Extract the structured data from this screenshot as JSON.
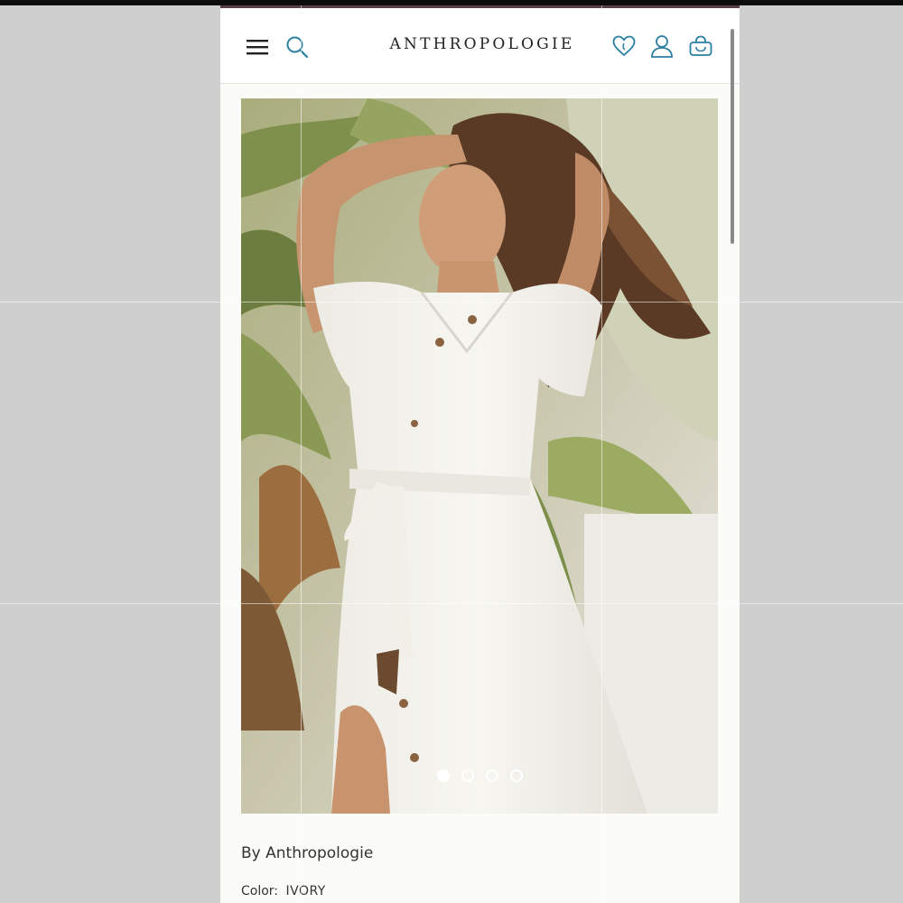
{
  "header": {
    "logo_text": "ANTHROPOLOGIE",
    "icons": [
      "menu-icon",
      "search-icon",
      "heart-icon",
      "user-icon",
      "bag-icon"
    ]
  },
  "gallery": {
    "slide_count": 4,
    "active_index": 0
  },
  "product": {
    "brand_line": "By Anthropologie",
    "color_label": "Color:",
    "color_value": "IVORY"
  },
  "colors": {
    "accent": "#2b7fa3",
    "text": "#222222",
    "page_bg": "#fbfbf7",
    "outer_bg": "#cfcfcf"
  }
}
